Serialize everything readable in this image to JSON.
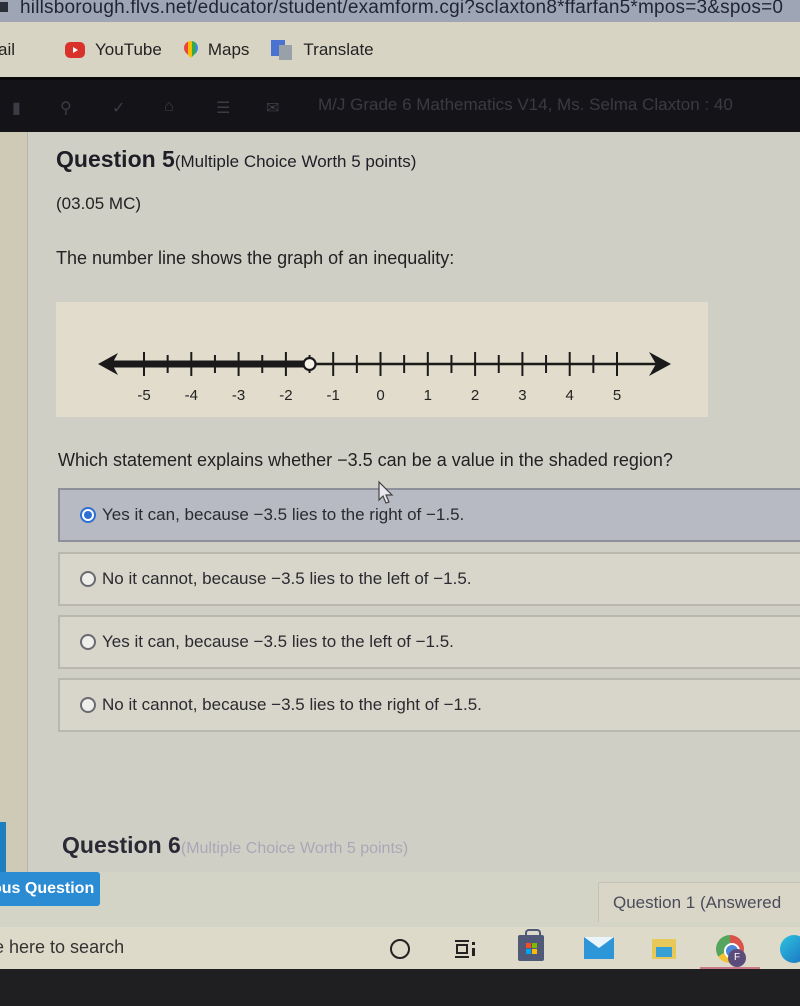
{
  "browser": {
    "url": "hillsborough.flvs.net/educator/student/examform.cgi?sclaxton8*ffarfan5*mpos=3&spos=0",
    "bookmarks": [
      {
        "label": "ail",
        "icon": "gmail-icon"
      },
      {
        "label": "YouTube",
        "icon": "youtube-icon"
      },
      {
        "label": "Maps",
        "icon": "maps-icon"
      },
      {
        "label": "Translate",
        "icon": "translate-icon"
      }
    ]
  },
  "app_nav": {
    "icons": [
      "menu-icon",
      "search-icon",
      "check-icon",
      "home-icon",
      "list-icon",
      "mail-icon"
    ],
    "course_title": "M/J Grade 6 Mathematics V14, Ms. Selma Claxton : 40"
  },
  "question5": {
    "number_label": "Question 5",
    "type_label": "(Multiple Choice Worth 5 points)",
    "code": "(03.05 MC)",
    "stem": "The number line shows the graph of an inequality:",
    "prompt": "Which statement explains whether −3.5 can be a value in the shaded region?",
    "choices": [
      {
        "label": "Yes it can, because −3.5 lies to the right of −1.5.",
        "selected": true
      },
      {
        "label": "No it cannot, because −3.5 lies to the left of −1.5.",
        "selected": false
      },
      {
        "label": "Yes it can, because −3.5 lies to the left of −1.5.",
        "selected": false
      },
      {
        "label": "No it cannot, because −3.5 lies to the right of −1.5.",
        "selected": false
      }
    ]
  },
  "number_line": {
    "min": -5.5,
    "max": 5.5,
    "labeled_ticks": [
      "-5",
      "-4",
      "-3",
      "-2",
      "-1",
      "0",
      "1",
      "2",
      "3",
      "4",
      "5"
    ],
    "minor_step": 0.5,
    "open_circle_at": -1.5,
    "shaded_direction": "left",
    "arrows": "both"
  },
  "question6": {
    "number_label": "Question 6",
    "type_label": "(Multiple Choice Worth 5 points)"
  },
  "footer": {
    "previous_button": "ous Question",
    "question_nav": "Question 1 (Answered"
  },
  "taskbar": {
    "search_placeholder": "e here to search",
    "apps": [
      "cortana-icon",
      "task-view-icon",
      "store-icon",
      "mail-icon",
      "file-explorer-icon",
      "chrome-icon",
      "edge-icon"
    ],
    "chrome_profile_initial": "F"
  },
  "colors": {
    "accent_blue": "#2b8bd3",
    "radio_selected": "#2d6fd3",
    "nav_dark": "#141418"
  }
}
